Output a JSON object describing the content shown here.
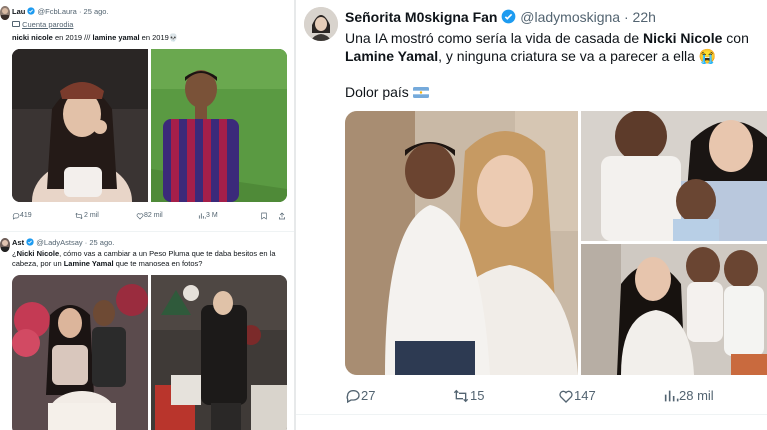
{
  "tweet1": {
    "name": "Lau",
    "handle": "@FcbLaura",
    "time": "25 ago.",
    "parody": "Cuenta parodia",
    "text_a": "nicki nicole",
    "text_b": " en 2019 /// ",
    "text_c": "lamine yamal",
    "text_d": " en 2019💀",
    "replies": "419",
    "retweets": "2 mil",
    "likes": "82 mil",
    "views": "3 M"
  },
  "tweet2": {
    "name": "Ast",
    "handle": "@LadyAstsay",
    "time": "25 ago.",
    "text_a": "¿",
    "text_b": "Nicki Nicole",
    "text_c": ", cómo vas a cambiar a un Peso Pluma que te daba besitos en la cabeza, por un ",
    "text_d": "Lamine Yamal",
    "text_e": " que te manosea en fotos?"
  },
  "main_tweet": {
    "name": "Señorita M0skigna Fan",
    "handle": "@ladymoskigna",
    "time": "22h",
    "text_a": "Una IA mostró como sería la vida de casada de ",
    "text_b": "Nicki Nicole",
    "text_c": " con ",
    "text_d": "Lamine Yamal",
    "text_e": ", y ninguna criatura se va a parecer a ella 😭",
    "text2": "Dolor país",
    "replies": "27",
    "retweets": "15",
    "likes": "147",
    "views": "28 mil"
  },
  "icons": {
    "verified": "verified-badge-icon",
    "reply": "reply-icon",
    "retweet": "retweet-icon",
    "like": "heart-icon",
    "views": "views-icon",
    "bookmark": "bookmark-icon",
    "share": "share-icon",
    "flag": "argentina-flag-icon"
  },
  "colors": {
    "accent": "#1d9bf0",
    "muted": "#536471",
    "text": "#0f1419"
  }
}
